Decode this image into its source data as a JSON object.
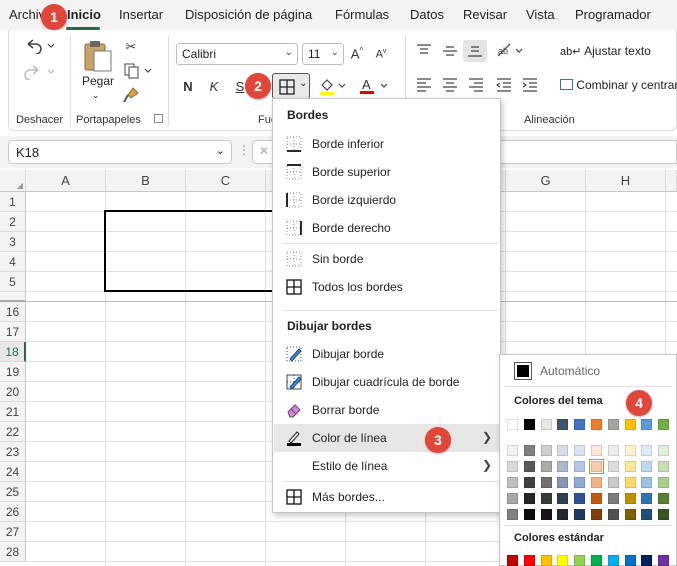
{
  "menu_tabs": [
    "Archivo",
    "Inicio",
    "Insertar",
    "Disposición de página",
    "Fórmulas",
    "Datos",
    "Revisar",
    "Vista",
    "Programador"
  ],
  "ribbon": {
    "undo_group": "Deshacer",
    "clipboard_group": "Portapapeles",
    "paste_label": "Pegar",
    "font_group": "Fuente",
    "align_group": "Alineación",
    "font_name": "Calibri",
    "font_size": "11",
    "bold": "N",
    "italic": "K",
    "underline": "S",
    "wrap_text": "Ajustar texto",
    "merge_center": "Combinar y centrar"
  },
  "badges": [
    "1",
    "2",
    "3",
    "4"
  ],
  "name_box": "K18",
  "columns": [
    "A",
    "B",
    "C",
    "D",
    "E",
    "F",
    "G",
    "H"
  ],
  "rows": [
    "1",
    "2",
    "3",
    "4",
    "5",
    "16",
    "17",
    "18",
    "19",
    "20",
    "21",
    "22",
    "23",
    "24",
    "25",
    "26",
    "27",
    "28"
  ],
  "selected_row": "18",
  "borders_menu": {
    "section1": "Bordes",
    "items1": [
      "Borde inferior",
      "Borde superior",
      "Borde izquierdo",
      "Borde derecho",
      "Sin borde",
      "Todos los bordes"
    ],
    "section2": "Dibujar bordes",
    "items2": [
      "Dibujar borde",
      "Dibujar cuadrícula de borde",
      "Borrar borde",
      "Color de línea",
      "Estilo de línea",
      "Más bordes..."
    ]
  },
  "color_menu": {
    "automatic": "Automático",
    "theme_colors": "Colores del tema",
    "standard_colors": "Colores estándar",
    "theme_base": [
      "#ffffff",
      "#000000",
      "#e7e6e6",
      "#44546a",
      "#4472c4",
      "#ed7d31",
      "#a5a5a5",
      "#ffc000",
      "#5b9bd5",
      "#70ad47"
    ],
    "theme_shades": [
      [
        "#f2f2f2",
        "#7f7f7f",
        "#d0cece",
        "#d6dce4",
        "#d9e2f3",
        "#fbe5d5",
        "#ededed",
        "#fff2cc",
        "#ddebf7",
        "#e2efd9"
      ],
      [
        "#d9d9d9",
        "#595959",
        "#aeaaaa",
        "#adb9ca",
        "#b4c6e7",
        "#f8cbad",
        "#dbdbdb",
        "#ffe699",
        "#bdd7ee",
        "#c5e0b3"
      ],
      [
        "#bfbfbf",
        "#404040",
        "#757070",
        "#8496b0",
        "#8eaadb",
        "#f4b183",
        "#c9c9c9",
        "#ffd966",
        "#9cc3e5",
        "#a8d08d"
      ],
      [
        "#a6a6a6",
        "#262626",
        "#3a3838",
        "#333f4f",
        "#2f5496",
        "#c55a11",
        "#7b7b7b",
        "#bf9000",
        "#2e75b5",
        "#538135"
      ],
      [
        "#808080",
        "#0d0d0d",
        "#171616",
        "#222a35",
        "#1f3864",
        "#833c0b",
        "#525252",
        "#7f6000",
        "#1f4e79",
        "#375623"
      ]
    ],
    "standard": [
      "#c00000",
      "#ff0000",
      "#ffc000",
      "#ffff00",
      "#92d050",
      "#00b050",
      "#00b0f0",
      "#0070c0",
      "#002060",
      "#7030a0"
    ]
  }
}
